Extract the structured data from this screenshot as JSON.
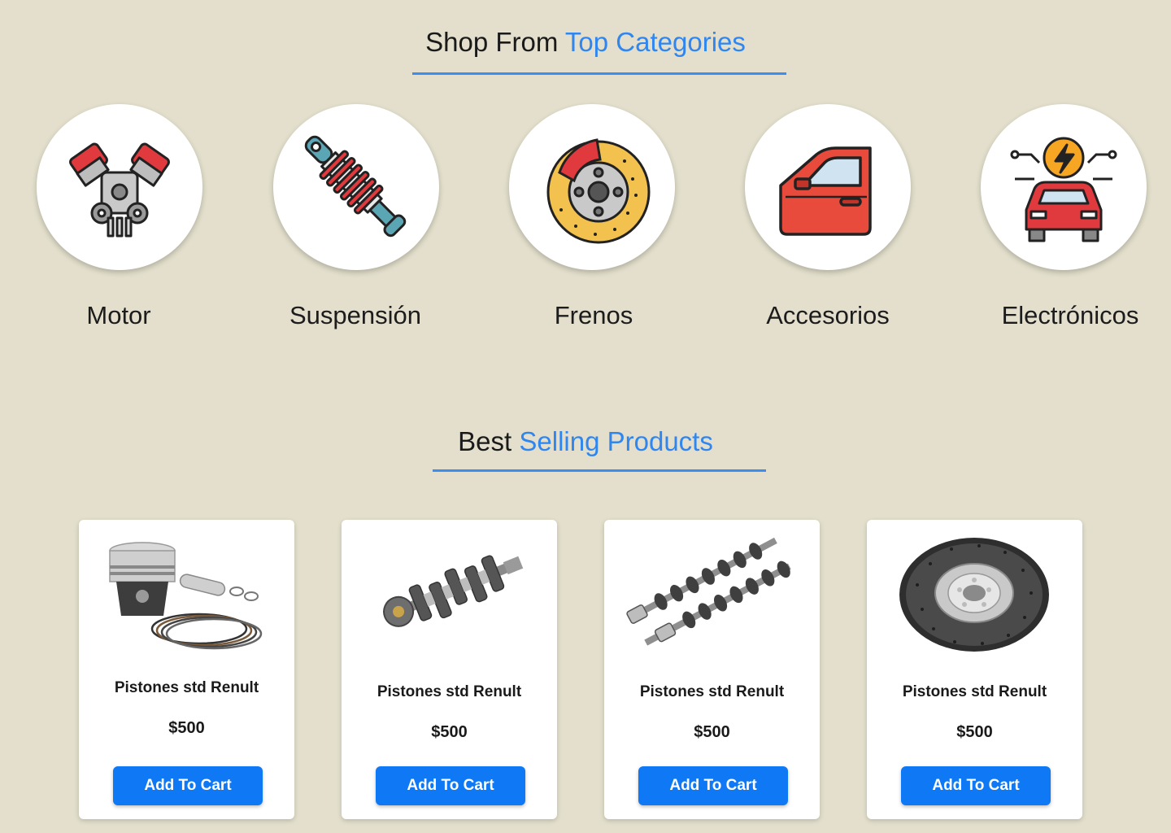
{
  "categories_section": {
    "title_prefix": "Shop From",
    "title_accent": "Top Categories",
    "items": [
      {
        "label": "Motor",
        "icon": "engine-icon"
      },
      {
        "label": "Suspensión",
        "icon": "shock-absorber-icon"
      },
      {
        "label": "Frenos",
        "icon": "brake-disc-icon"
      },
      {
        "label": "Accesorios",
        "icon": "car-door-icon"
      },
      {
        "label": "Electrónicos",
        "icon": "electric-car-icon"
      }
    ]
  },
  "products_section": {
    "title_prefix": "Best",
    "title_accent": "Selling Products",
    "products": [
      {
        "name": "Pistones std Renult",
        "price": "$500",
        "button": "Add To Cart",
        "image": "piston-kit-image"
      },
      {
        "name": "Pistones std Renult",
        "price": "$500",
        "button": "Add To Cart",
        "image": "crankshaft-image"
      },
      {
        "name": "Pistones std Renult",
        "price": "$500",
        "button": "Add To Cart",
        "image": "camshaft-image"
      },
      {
        "name": "Pistones std Renult",
        "price": "$500",
        "button": "Add To Cart",
        "image": "brake-rotor-image"
      }
    ]
  },
  "colors": {
    "accent": "#2f86f0",
    "button": "#0f78f5",
    "background": "#e3dfcc"
  }
}
